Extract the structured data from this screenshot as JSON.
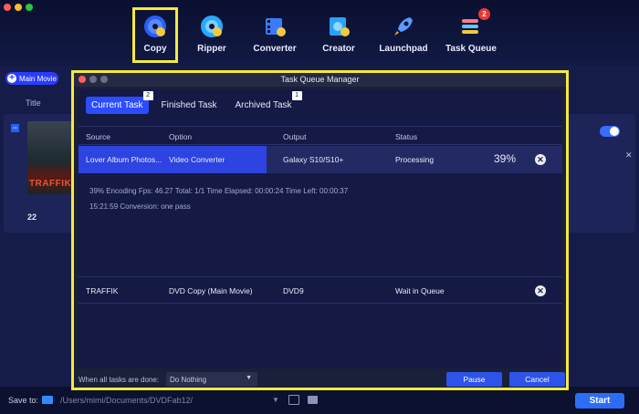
{
  "window": {
    "traffic": [
      "close",
      "minimize",
      "zoom"
    ]
  },
  "nav": [
    {
      "label": "Copy",
      "icon": "disc-copy-icon"
    },
    {
      "label": "Ripper",
      "icon": "disc-ripper-icon"
    },
    {
      "label": "Converter",
      "icon": "film-converter-icon"
    },
    {
      "label": "Creator",
      "icon": "disc-creator-icon"
    },
    {
      "label": "Launchpad",
      "icon": "rocket-icon"
    },
    {
      "label": "Task Queue",
      "icon": "task-queue-icon",
      "badge": "2"
    }
  ],
  "background": {
    "main_movie_label": "Main Movie",
    "title_column": "Title",
    "poster_text": "TRAFFIK",
    "count": "22"
  },
  "tqm": {
    "title": "Task Queue Manager",
    "tabs": [
      {
        "label": "Current Task",
        "badge": "2"
      },
      {
        "label": "Finished Task",
        "badge": ""
      },
      {
        "label": "Archived Task",
        "badge": "1"
      }
    ],
    "columns": [
      "Source",
      "Option",
      "Output",
      "Status"
    ],
    "rows": [
      {
        "source": "Lover Album Photos...",
        "option": "Video Converter",
        "output": "Galaxy S10/S10+",
        "status": "Processing",
        "percent": "39%"
      },
      {
        "source": "TRAFFIK",
        "option": "DVD Copy (Main Movie)",
        "output": "DVD9",
        "status": "Wait in Queue"
      }
    ],
    "details": {
      "line1": "39%  Encoding Fps: 46.27   Total: 1/1   Time Elapsed: 00:00:24   Time Left: 00:00:37",
      "line2": "15:21:59  Conversion: one pass"
    },
    "footer": {
      "when_done_label": "When all tasks are done:",
      "when_done_value": "Do Nothing",
      "pause_label": "Pause",
      "cancel_label": "Cancel"
    }
  },
  "bottom": {
    "save_to_label": "Save to:",
    "path": "/Users/mimi/Documents/DVDFab12/",
    "start_label": "Start"
  },
  "colors": {
    "accent": "#2d44e0",
    "highlight": "#f6ea3c",
    "badge": "#e53935"
  }
}
